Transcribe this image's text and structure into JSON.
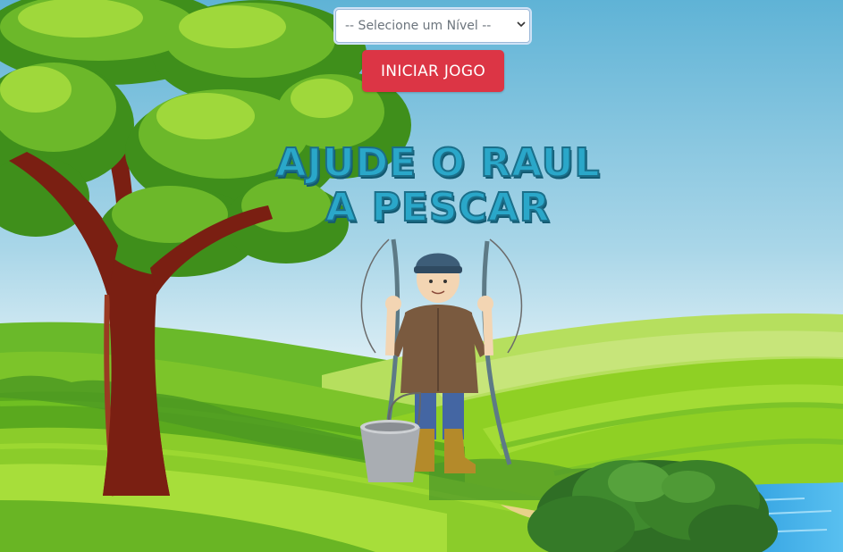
{
  "game": {
    "level_select": {
      "selected": "-- Selecione um Nível --",
      "options": [
        "-- Selecione um Nível --"
      ]
    },
    "start_button_label": "INICIAR JOGO",
    "title_line1": "AJUDE O RAUL",
    "title_line2": "A PESCAR"
  },
  "colors": {
    "sky_top": "#5fb3d6",
    "sky_bottom": "#e6f3f8",
    "grass_light": "#9ed81b",
    "grass_dark": "#4fa51c",
    "title_fill": "#2aa7c9",
    "button": "#dc3545",
    "water": "#3fa9e8"
  },
  "icons": [
    "tree",
    "fisherman",
    "fishing-rod",
    "bucket",
    "bush",
    "river"
  ]
}
